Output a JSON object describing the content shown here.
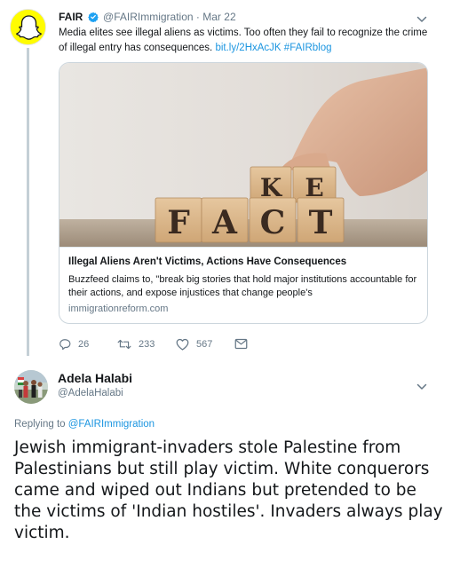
{
  "tweet1": {
    "display_name": "FAIR",
    "handle": "@FAIRImmigration",
    "separator": "·",
    "date": "Mar 22",
    "text_main": "Media elites see illegal aliens as victims. Too often they fail to recognize the crime of illegal entry has consequences. ",
    "text_link": "bit.ly/2HxAcJK",
    "text_hashtag": "#FAIRblog",
    "card": {
      "image_letters_bottom": [
        "F",
        "A",
        "C",
        "T"
      ],
      "image_letters_top": [
        "K",
        "E"
      ],
      "title": "Illegal Aliens Aren't Victims, Actions Have Consequences",
      "description": "Buzzfeed claims to, \"break big stories that hold major institutions accountable for their actions, and expose injustices that change people's",
      "domain": "immigrationreform.com"
    },
    "actions": {
      "replies": "26",
      "retweets": "233",
      "likes": "567"
    },
    "icons": {
      "verified": "verified-badge-icon",
      "reply": "reply-icon",
      "retweet": "retweet-icon",
      "like": "heart-icon",
      "dm": "envelope-icon",
      "menu": "chevron-down-icon"
    }
  },
  "tweet2": {
    "display_name": "Adela Halabi",
    "handle": "@AdelaHalabi",
    "replying_prefix": "Replying to ",
    "replying_handle": "@FAIRImmigration",
    "text": "Jewish immigrant-invaders stole Palestine from Palestinians but still play victim. White conquerors came and wiped out Indians but pretended to be the victims of 'Indian hostiles'. Invaders always play victim."
  },
  "colors": {
    "link": "#1b95e0",
    "muted": "#657786",
    "verified": "#1da1f2",
    "avatar_fair": "#fffc00",
    "thread_line": "#c4cfd6",
    "border": "#ccd6dd"
  }
}
